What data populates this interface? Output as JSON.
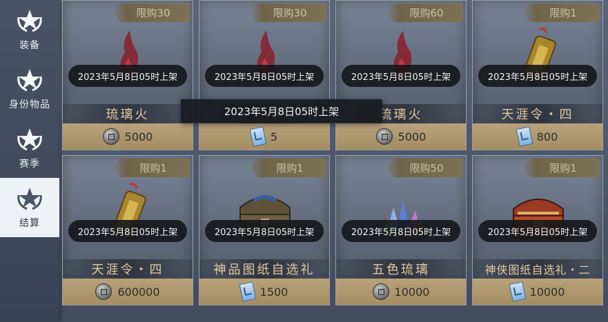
{
  "sidebar": {
    "items": [
      {
        "label": "装备",
        "icon": "star-laurel-icon",
        "active": false
      },
      {
        "label": "身份物品",
        "icon": "star-laurel-icon",
        "active": false
      },
      {
        "label": "赛季",
        "icon": "star-laurel-icon",
        "active": false
      },
      {
        "label": "结算",
        "icon": "star-laurel-icon",
        "active": true
      }
    ]
  },
  "tooltip": {
    "text": "2023年5月8日05时上架"
  },
  "cards": [
    {
      "limit": "限购30",
      "date": "2023年5月8日05时上架",
      "name": "琉璃火",
      "price": "5000",
      "currency": "coin-icon",
      "art": "red-flame-icon"
    },
    {
      "limit": "限购30",
      "date": "2023年5月8日05时上架",
      "name": "",
      "price": "5",
      "currency": "ticket-icon",
      "art": "red-flame-icon"
    },
    {
      "limit": "限购60",
      "date": "2023年5月8日05时上架",
      "name": "琉璃火",
      "price": "5000",
      "currency": "coin-icon",
      "art": "red-flame-icon"
    },
    {
      "limit": "限购1",
      "date": "2023年5月8日05时上架",
      "name": "天涯令・四",
      "price": "800",
      "currency": "ticket-icon",
      "art": "gold-token-icon"
    },
    {
      "limit": "限购1",
      "date": "2023年5月8日05时上架",
      "name": "天涯令・四",
      "price": "600000",
      "currency": "coin-icon",
      "art": "gold-token-icon"
    },
    {
      "limit": "限购1",
      "date": "2023年5月8日05时上架",
      "name": "神品图纸自选礼",
      "price": "1500",
      "currency": "ticket-icon",
      "art": "treasure-chest-icon"
    },
    {
      "limit": "限购50",
      "date": "2023年5月8日05时上架",
      "name": "五色琉璃",
      "price": "10000",
      "currency": "coin-icon",
      "art": "crystal-cluster-icon"
    },
    {
      "limit": "限购1",
      "date": "2023年5月8日05时上架",
      "name": "神侠图纸自选礼・二",
      "price": "10000",
      "currency": "ticket-icon",
      "art": "red-chest-icon"
    }
  ]
}
